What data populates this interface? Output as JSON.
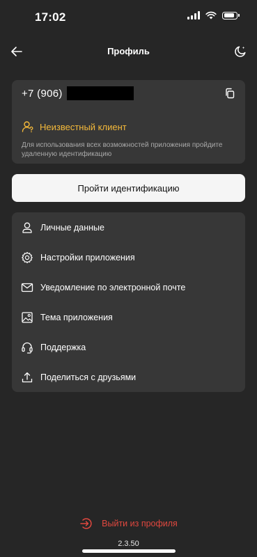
{
  "status_bar": {
    "time": "17:02",
    "icons": [
      "signal-icon",
      "wifi-icon",
      "battery-icon"
    ]
  },
  "header": {
    "title": "Профиль",
    "back_icon": "arrow-left-icon",
    "theme_icon": "moon-sparkle-icon"
  },
  "client": {
    "phone_prefix": "+7 (906)",
    "copy_icon": "copy-icon",
    "status": "Неизвестный клиент",
    "description": "Для использования всех возможностей приложения пройдите удаленную идентификацию"
  },
  "identification_button": "Пройти идентификацию",
  "menu": {
    "items": [
      {
        "label": "Личные данные",
        "icon": "user-icon"
      },
      {
        "label": "Настройки приложения",
        "icon": "gear-icon"
      },
      {
        "label": "Уведомление по электронной почте",
        "icon": "envelope-icon"
      },
      {
        "label": "Тема приложения",
        "icon": "image-icon"
      },
      {
        "label": "Поддержка",
        "icon": "headset-icon"
      },
      {
        "label": "Поделиться с друзьями",
        "icon": "share-icon"
      }
    ]
  },
  "logout": {
    "label": "Выйти из профиля",
    "icon": "logout-icon"
  },
  "version": "2.3.50",
  "colors": {
    "background": "#262626",
    "card": "#373737",
    "accent_yellow": "#f4b93a",
    "danger_red": "#e0483f",
    "button_bg": "#f5f5f5"
  }
}
